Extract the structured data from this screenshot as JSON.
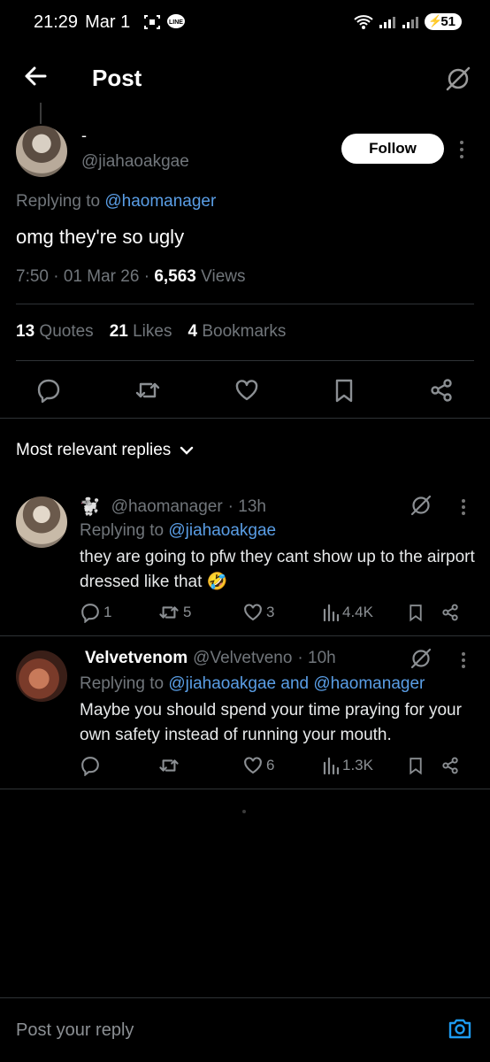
{
  "status_bar": {
    "time": "21:29",
    "date": "Mar 1",
    "battery": "51"
  },
  "header": {
    "title": "Post"
  },
  "post": {
    "display_name": "-",
    "handle": "@jiahaoakgae",
    "follow_label": "Follow",
    "replying_prefix": "Replying to",
    "replying_to": "@haomanager",
    "text": "omg they're so ugly",
    "time": "7:50 · 01 Mar 26 ·",
    "views_count": "6,563",
    "views_label": "Views",
    "stats": [
      {
        "count": "13",
        "label": "Quotes"
      },
      {
        "count": "21",
        "label": "Likes"
      },
      {
        "count": "4",
        "label": "Bookmarks"
      }
    ]
  },
  "sort": {
    "label": "Most relevant replies"
  },
  "replies": [
    {
      "emoji": "🐩",
      "display_name": "",
      "handle": "@haomanager",
      "age": "· 13h",
      "replying_prefix": "Replying to",
      "replying_to": "@jiahaoakgae",
      "text": "they are going to pfw they cant show up to the airport dressed like that 🤣",
      "replies": "1",
      "reposts": "5",
      "likes": "3",
      "views": "4.4K"
    },
    {
      "emoji": "",
      "display_name": "Velvetvenom",
      "handle": "@Velvetveno",
      "age": "· 10h",
      "replying_prefix": "Replying to",
      "replying_to": "@jiahaoakgae and @haomanager",
      "text": "Maybe you should spend your time praying for your own safety instead of running your mouth.",
      "replies": "",
      "reposts": "",
      "likes": "6",
      "views": "1.3K"
    }
  ],
  "composer": {
    "placeholder": "Post your reply"
  },
  "colors": {
    "background": "#000000",
    "link": "#5a9ee6",
    "muted": "#71767b",
    "icon_accent": "#1d9bf0"
  }
}
